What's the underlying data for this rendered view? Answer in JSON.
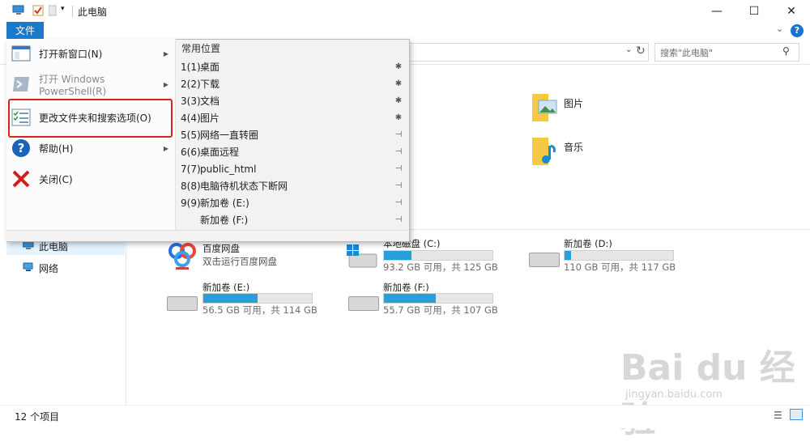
{
  "window": {
    "title": "此电脑",
    "minimize": "—",
    "maximize": "☐",
    "close": "✕",
    "help": "?"
  },
  "menu": {
    "file_tab": "文件",
    "items": [
      {
        "label": "打开新窗口(N)",
        "arrow": "▶",
        "enabled": true,
        "icon": "new-window-icon"
      },
      {
        "label": "打开 Windows PowerShell(R)",
        "arrow": "▶",
        "enabled": false,
        "icon": "powershell-icon"
      },
      {
        "label": "更改文件夹和搜索选项(O)",
        "arrow": "",
        "enabled": true,
        "icon": "folder-options-icon",
        "highlighted": true
      },
      {
        "label": "帮助(H)",
        "arrow": "▶",
        "enabled": true,
        "icon": "help-icon"
      },
      {
        "label": "关闭(C)",
        "arrow": "",
        "enabled": true,
        "icon": "close-x-icon"
      }
    ],
    "recent_title": "常用位置",
    "recent": [
      {
        "num": "1(1)",
        "label": "桌面",
        "pinned": true
      },
      {
        "num": "2(2)",
        "label": "下载",
        "pinned": true
      },
      {
        "num": "3(3)",
        "label": "文档",
        "pinned": true
      },
      {
        "num": "4(4)",
        "label": "图片",
        "pinned": true
      },
      {
        "num": "5(5)",
        "label": "网络一直转圈",
        "pinned": false
      },
      {
        "num": "6(6)",
        "label": "桌面远程",
        "pinned": false
      },
      {
        "num": "7(7)",
        "label": "public_html",
        "pinned": false
      },
      {
        "num": "8(8)",
        "label": "电脑待机状态下断网",
        "pinned": false
      },
      {
        "num": "9(9)",
        "label": "新加卷 (E:)",
        "pinned": false
      },
      {
        "num": "",
        "label": "新加卷 (F:)",
        "pinned": false
      }
    ]
  },
  "search": {
    "placeholder": "搜索\"此电脑\""
  },
  "nav": {
    "this_pc": "此电脑",
    "network": "网络"
  },
  "folders": [
    {
      "label": "图片"
    },
    {
      "label": "音乐"
    }
  ],
  "devices": {
    "baidu": {
      "name": "百度网盘",
      "desc": "双击运行百度网盘"
    },
    "drives": [
      {
        "name": "本地磁盘 (C:)",
        "info": "93.2 GB 可用，共 125 GB",
        "used_fraction": 0.25
      },
      {
        "name": "新加卷 (D:)",
        "info": "110 GB 可用，共 117 GB",
        "used_fraction": 0.06
      },
      {
        "name": "新加卷 (E:)",
        "info": "56.5 GB 可用，共 114 GB",
        "used_fraction": 0.5
      },
      {
        "name": "新加卷 (F:)",
        "info": "55.7 GB 可用，共 107 GB",
        "used_fraction": 0.48
      }
    ]
  },
  "status": {
    "items": "12 个项目"
  },
  "watermark": {
    "brand": "Bai du 经验",
    "url": "jingyan.baidu.com"
  },
  "colors": {
    "accent": "#1979ca",
    "highlight": "#e02020",
    "drive_fill": "#26a0da"
  }
}
